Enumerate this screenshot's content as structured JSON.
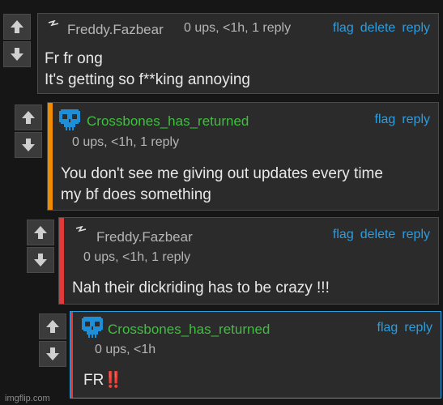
{
  "comments": [
    {
      "username": "Freddy.Fazbear",
      "meta": "0 ups, <1h, 1 reply",
      "actions": [
        "flag",
        "delete",
        "reply"
      ],
      "lines": [
        "Fr fr ong",
        "It's getting so f**king annoying"
      ]
    },
    {
      "username": "Crossbones_has_returned",
      "meta": "0 ups, <1h, 1 reply",
      "actions": [
        "flag",
        "reply"
      ],
      "lines": [
        "You don't see me giving out updates every time",
        "my bf does something"
      ]
    },
    {
      "username": "Freddy.Fazbear",
      "meta": "0 ups, <1h, 1 reply",
      "actions": [
        "flag",
        "delete",
        "reply"
      ],
      "lines": [
        "Nah their dickriding has to be crazy !!!"
      ]
    },
    {
      "username": "Crossbones_has_returned",
      "meta": "0 ups, <1h",
      "actions": [
        "flag",
        "reply"
      ],
      "text": "FR",
      "emoji": "‼️"
    }
  ],
  "watermark": "imgflip.com",
  "colors": {
    "accent_orange": "#f08c00",
    "accent_red": "#e03a3a",
    "username_green": "#3fbf3f",
    "link_blue": "#2a9ee0",
    "skull_blue": "#1e8fd6"
  },
  "icons": {
    "upvote": "up-arrow-icon",
    "downvote": "down-arrow-icon",
    "freddy_avatar": "lightning-icon",
    "crossbones_avatar": "skull-icon"
  }
}
